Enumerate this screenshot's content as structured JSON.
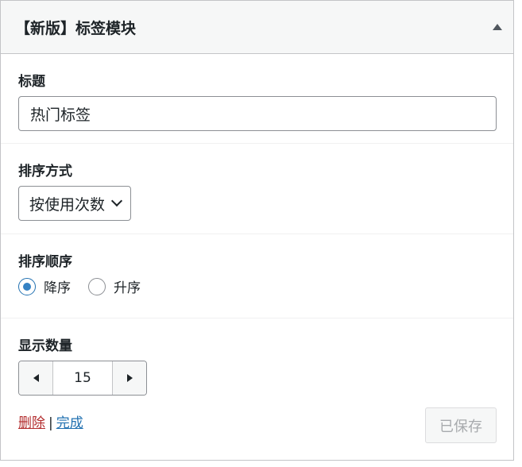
{
  "widget": {
    "title": "【新版】标签模块"
  },
  "title_field": {
    "label": "标题",
    "value": "热门标签"
  },
  "orderby_field": {
    "label": "排序方式",
    "selected": "按使用次数"
  },
  "order_field": {
    "label": "排序顺序",
    "options": [
      {
        "label": "降序",
        "checked": true
      },
      {
        "label": "升序",
        "checked": false
      }
    ]
  },
  "count_field": {
    "label": "显示数量",
    "value": "15"
  },
  "footer": {
    "delete_label": "删除",
    "separator": "|",
    "done_label": "完成",
    "saved_label": "已保存"
  },
  "colors": {
    "accent": "#2271b1",
    "radio_dot": "#3582c4",
    "delete": "#b32d2e",
    "border": "#c3c4c7",
    "header_bg": "#f6f7f7"
  },
  "icons": {
    "collapse": "triangle-up-icon",
    "select": "chevron-down-icon",
    "decrement": "triangle-left-icon",
    "increment": "triangle-right-icon"
  }
}
